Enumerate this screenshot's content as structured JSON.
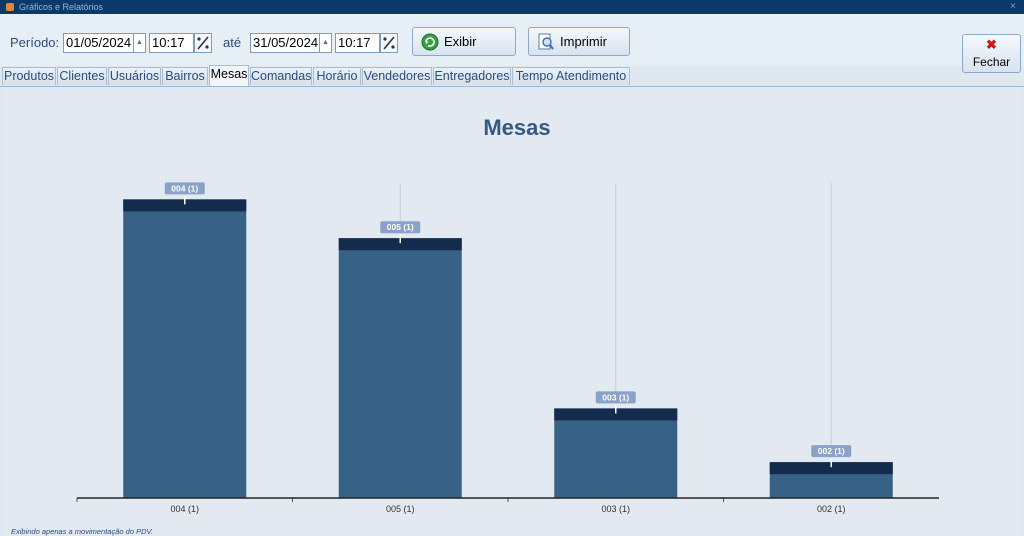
{
  "window": {
    "title": "Gráficos e Relatórios",
    "close_glyph": "×"
  },
  "toolbar": {
    "periodo_label": "Período:",
    "start_date": "01/05/2024",
    "start_time": "10:17",
    "ate_label": "até",
    "end_date": "31/05/2024",
    "end_time": "10:17",
    "exibir_label": "Exibir",
    "imprimir_label": "Imprimir",
    "fechar_label": "Fechar"
  },
  "tabs": [
    "Produtos",
    "Clientes",
    "Usuários",
    "Bairros",
    "Mesas",
    "Comandas",
    "Horário",
    "Vendedores",
    "Entregadores",
    "Tempo Atendimento"
  ],
  "active_tab": "Mesas",
  "colors": {
    "bar": "#376285",
    "bar_top": "#132c4d",
    "label_bg": "#8ba2c8",
    "title": "#36597f"
  },
  "chart_data": {
    "type": "bar",
    "title": "Mesas",
    "categories": [
      "004 (1)",
      "005 (1)",
      "003 (1)",
      "002 (1)"
    ],
    "values": [
      100,
      87,
      30,
      12
    ],
    "data_labels": [
      "004 (1)",
      "005 (1)",
      "003 (1)",
      "002 (1)"
    ],
    "ylim": [
      0,
      100
    ],
    "grid": true,
    "legend": "none"
  },
  "footer": {
    "note": "Exibindo apenas a movimentação do PDV."
  }
}
